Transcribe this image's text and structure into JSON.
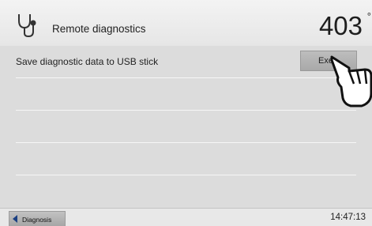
{
  "header": {
    "title": "Remote diagnostics",
    "temperature": "403",
    "temperature_unit": "°"
  },
  "rows": [
    {
      "label": "Save diagnostic data to USB stick",
      "button_label": "Exec"
    }
  ],
  "footer": {
    "back_label": "Diagnosis",
    "time": "14:47:13"
  },
  "colors": {
    "back_arrow": "#1a3f82",
    "background": "#dcdcdc"
  },
  "icons": {
    "header": "stethoscope-icon",
    "pointer": "pointing-hand-icon",
    "back": "back-arrow-icon"
  }
}
